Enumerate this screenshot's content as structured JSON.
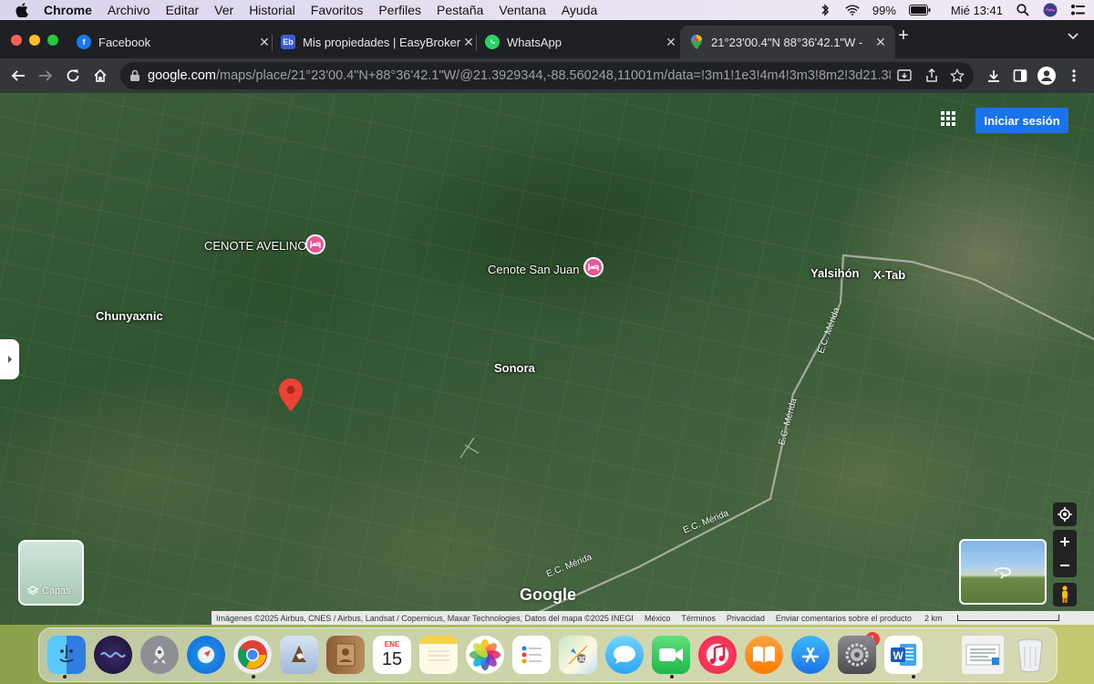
{
  "menubar": {
    "app": "Chrome",
    "items": [
      "Archivo",
      "Editar",
      "Ver",
      "Historial",
      "Favoritos",
      "Perfiles",
      "Pestaña",
      "Ventana",
      "Ayuda"
    ],
    "battery": "99%",
    "clock": "Mié 13:41"
  },
  "tabs": [
    {
      "title": "Facebook",
      "icon": "facebook-icon",
      "color": "#1877f2"
    },
    {
      "title": "Mis propiedades | EasyBroker",
      "icon": "easybroker-icon",
      "color": "#3b5bdb"
    },
    {
      "title": "WhatsApp",
      "icon": "whatsapp-icon",
      "color": "#25d366"
    },
    {
      "title": "21°23'00.4\"N 88°36'42.1\"W - ",
      "icon": "google-maps-icon",
      "color": "#34a853",
      "active": true
    }
  ],
  "toolbar": {
    "url_host": "google.com",
    "url_path": "/maps/place/21°23'00.4\"N+88°36'42.1\"W/@21.3929344,-88.560248,11001m/data=!3m1!1e3!4m4!3m3!8m2!3d21.383..."
  },
  "map": {
    "signin_label": "Iniciar sesión",
    "labels": {
      "cenote_avelino": "CENOTE AVELINO",
      "cenote_san_juan": "Cenote San Juan",
      "chunyaxnic": "Chunyaxnic",
      "sonora": "Sonora",
      "yalsihon": "Yalsihón",
      "xtab": "X-Tab"
    },
    "roads": [
      "E.C. Mérida",
      "E.C. Mérida",
      "E.C. Mérida",
      "E.C. Mérida"
    ],
    "layers_label": "Capas",
    "logo": "Google",
    "attribution": {
      "imagery": "Imágenes ©2025 Airbus, CNES / Airbus, Landsat / Copernicus, Maxar Technologies, Datos del mapa ©2025 INEGI",
      "country": "México",
      "terms": "Términos",
      "privacy": "Privacidad",
      "feedback": "Enviar comentarios sobre el producto",
      "scale": "2 km"
    }
  },
  "dock": {
    "apps": [
      {
        "name": "finder-icon",
        "color": "#3a8ee6"
      },
      {
        "name": "siri-icon",
        "color": "#5b3fc4"
      },
      {
        "name": "launchpad-icon",
        "color": "#8c8c94"
      },
      {
        "name": "safari-icon",
        "color": "#1e88e5"
      },
      {
        "name": "chrome-icon",
        "color": "#e8eaed"
      },
      {
        "name": "preview-icon",
        "color": "#6b8fbf"
      },
      {
        "name": "contacts-icon",
        "color": "#b98b5c"
      },
      {
        "name": "calendar-icon",
        "color": "#ffffff"
      },
      {
        "name": "notes-icon",
        "color": "#f5d547"
      },
      {
        "name": "photos-icon",
        "color": "#ffffff"
      },
      {
        "name": "reminders-icon",
        "color": "#ffffff"
      },
      {
        "name": "maps-icon",
        "color": "#7fc47f"
      },
      {
        "name": "messages-icon",
        "color": "#4cb7ff"
      },
      {
        "name": "facetime-icon",
        "color": "#3ccf5a"
      },
      {
        "name": "music-icon",
        "color": "#fa3c5a"
      },
      {
        "name": "books-icon",
        "color": "#ff8a1f"
      },
      {
        "name": "app-store-icon",
        "color": "#1e90ff"
      },
      {
        "name": "system-preferences-icon",
        "color": "#6e6e73"
      },
      {
        "name": "word-icon",
        "color": "#2b5cad"
      },
      {
        "name": "screenshot-thumbnail-icon",
        "color": "#e8e8e8"
      },
      {
        "name": "trash-icon",
        "color": "#d9dde2"
      }
    ],
    "calendar_month": "ENE",
    "calendar_day": "15",
    "app_store_badge": "1"
  }
}
